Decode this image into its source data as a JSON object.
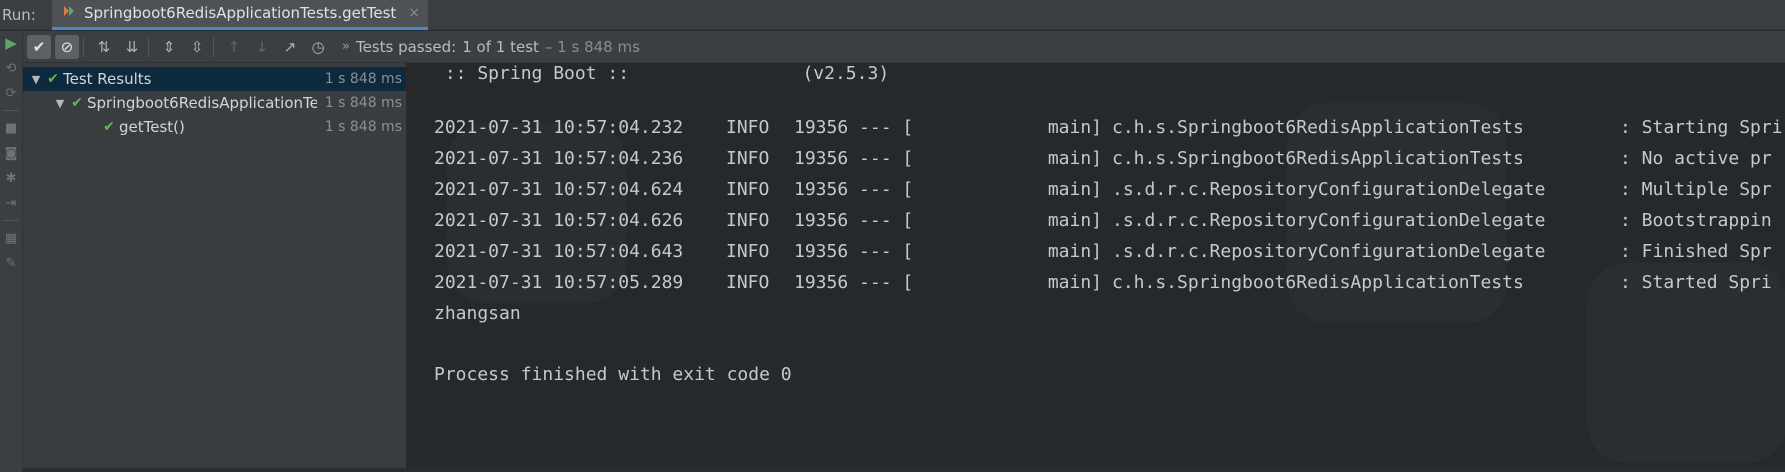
{
  "run_label": "Run:",
  "tab": {
    "title": "Springboot6RedisApplicationTests.getTest",
    "close": "×"
  },
  "status": {
    "prefix": "Tests passed:",
    "count": "1 of 1 test",
    "duration": "– 1 s 848 ms"
  },
  "tree": [
    {
      "label": "Test Results",
      "duration": "1 s 848 ms"
    },
    {
      "label": "Springboot6RedisApplicationTe",
      "duration": "1 s 848 ms"
    },
    {
      "label": "getTest()",
      "duration": "1 s 848 ms"
    }
  ],
  "console": {
    "banner": " :: Spring Boot ::                (v2.5.3)",
    "logs": [
      {
        "ts": "2021-07-31 10:57:04.232",
        "level": "INFO",
        "pid": "19356 --- [",
        "thread": "main]",
        "logger": "c.h.s.Springboot6RedisApplicationTests",
        "msg": ": Starting Spri"
      },
      {
        "ts": "2021-07-31 10:57:04.236",
        "level": "INFO",
        "pid": "19356 --- [",
        "thread": "main]",
        "logger": "c.h.s.Springboot6RedisApplicationTests",
        "msg": ": No active pr"
      },
      {
        "ts": "2021-07-31 10:57:04.624",
        "level": "INFO",
        "pid": "19356 --- [",
        "thread": "main]",
        "logger": ".s.d.r.c.RepositoryConfigurationDelegate",
        "msg": ": Multiple Spr"
      },
      {
        "ts": "2021-07-31 10:57:04.626",
        "level": "INFO",
        "pid": "19356 --- [",
        "thread": "main]",
        "logger": ".s.d.r.c.RepositoryConfigurationDelegate",
        "msg": ": Bootstrappin"
      },
      {
        "ts": "2021-07-31 10:57:04.643",
        "level": "INFO",
        "pid": "19356 --- [",
        "thread": "main]",
        "logger": ".s.d.r.c.RepositoryConfigurationDelegate",
        "msg": ": Finished Spr"
      },
      {
        "ts": "2021-07-31 10:57:05.289",
        "level": "INFO",
        "pid": "19356 --- [",
        "thread": "main]",
        "logger": "c.h.s.Springboot6RedisApplicationTests",
        "msg": ": Started Spri"
      }
    ],
    "output": "zhangsan",
    "exit": "Process finished with exit code 0"
  },
  "colors": {
    "pass": "#5fb84a",
    "accent": "#4a88c7",
    "selection": "#0d293e"
  }
}
